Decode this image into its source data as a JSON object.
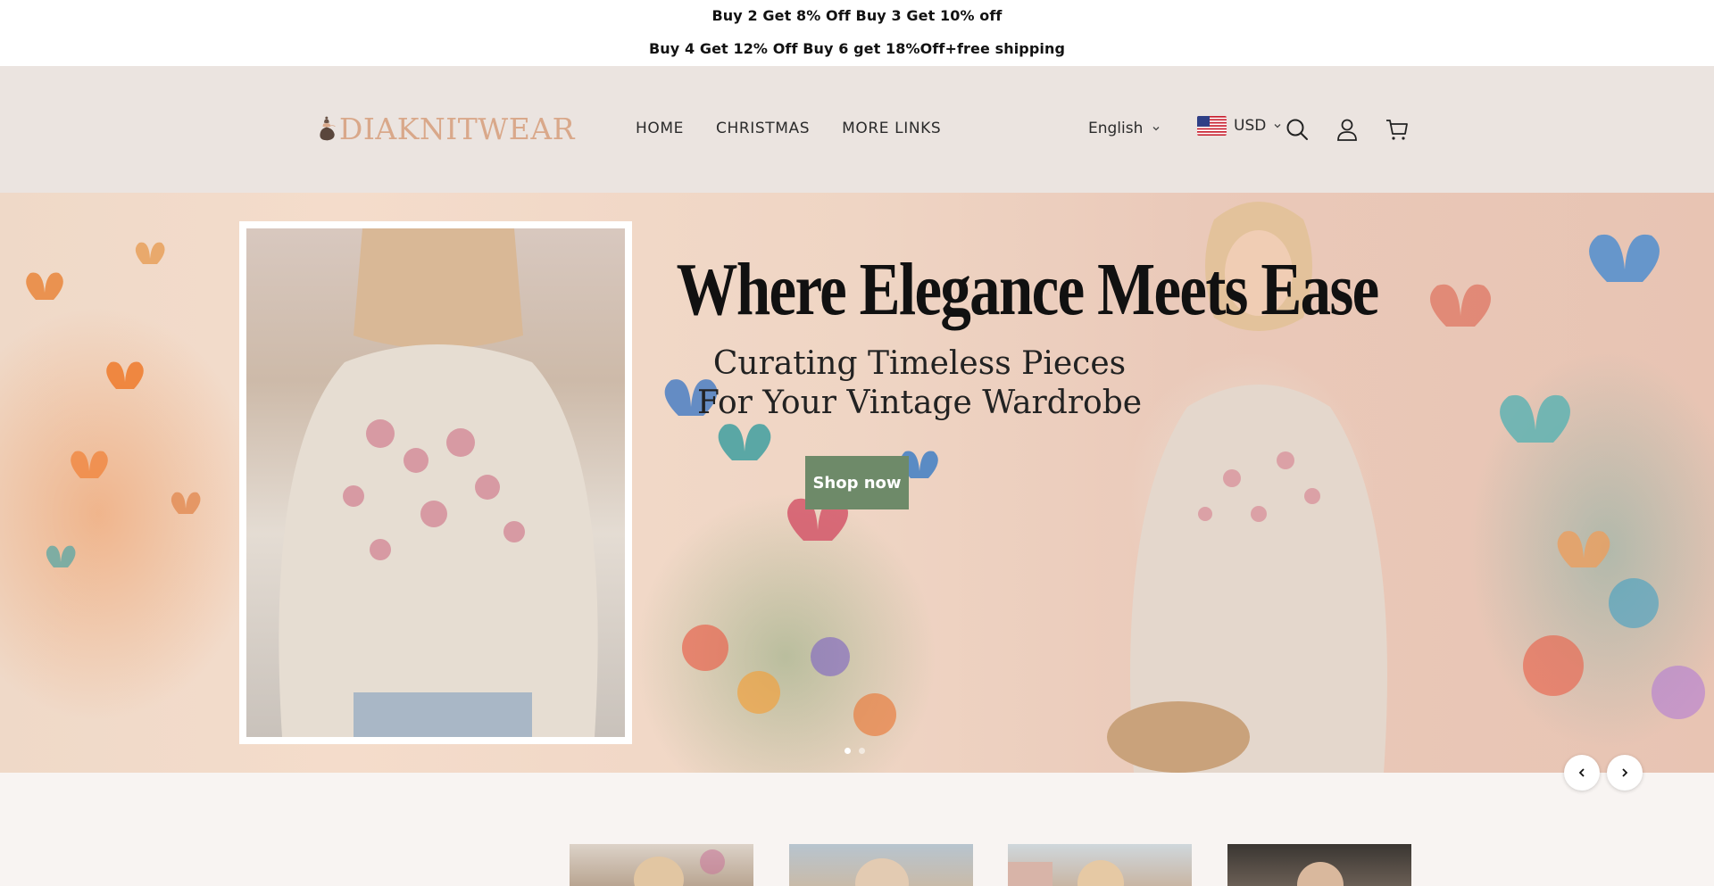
{
  "announcement": {
    "line1": "Buy 2 Get 8% Off Buy 3 Get 10% off",
    "line2": "Buy 4 Get 12% Off Buy 6 get 18%Off+free shipping"
  },
  "header": {
    "logo_text": "DIAKNITWEAR",
    "nav": [
      "HOME",
      "CHRISTMAS",
      "MORE LINKS"
    ],
    "language": "English",
    "currency": "USD",
    "icons": [
      "search-icon",
      "account-icon",
      "cart-icon"
    ]
  },
  "hero": {
    "headline": "Where Elegance Meets Ease",
    "subtitle_line1": "Curating Timeless Pieces",
    "subtitle_line2": "For Your Vintage Wardrobe",
    "button_label": "Shop now",
    "slides": 2,
    "active_slide": 1,
    "button_color": "#6e8a69"
  },
  "colors": {
    "header_bg": "#ebe4e0",
    "logo": "#d9a88a",
    "page_bg": "#f8f4f2"
  }
}
